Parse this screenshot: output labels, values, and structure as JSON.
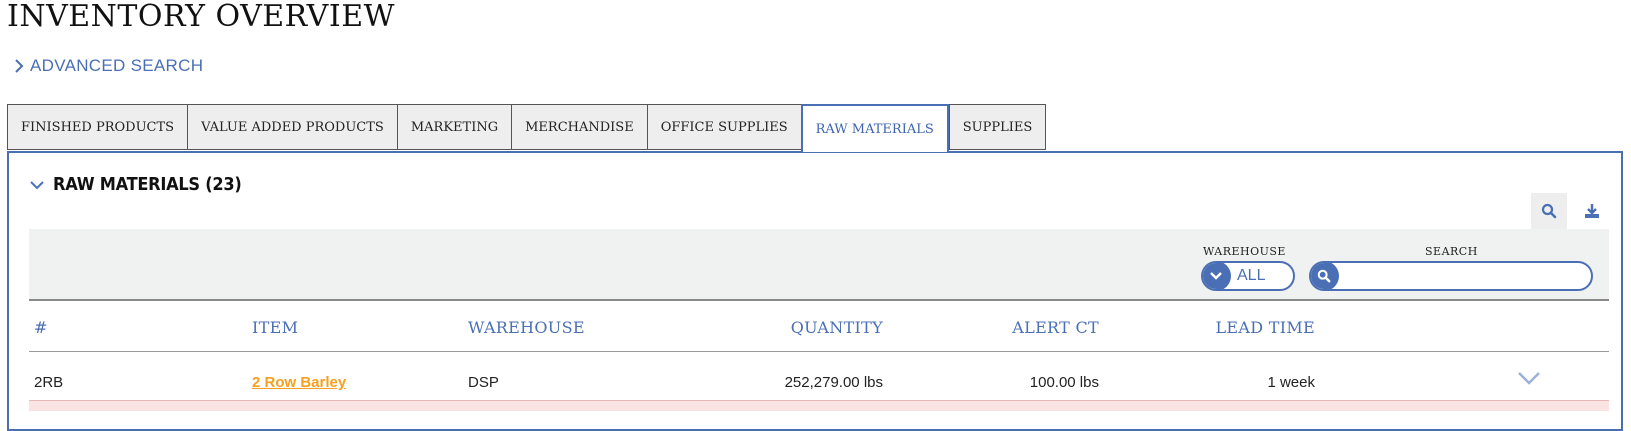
{
  "page": {
    "title": "INVENTORY OVERVIEW"
  },
  "advanced_search": {
    "label": "ADVANCED SEARCH"
  },
  "tabs": [
    {
      "label": "FINISHED PRODUCTS",
      "active": false
    },
    {
      "label": "VALUE ADDED PRODUCTS",
      "active": false
    },
    {
      "label": "MARKETING",
      "active": false
    },
    {
      "label": "MERCHANDISE",
      "active": false
    },
    {
      "label": "OFFICE SUPPLIES",
      "active": false
    },
    {
      "label": "RAW MATERIALS",
      "active": true
    },
    {
      "label": "SUPPLIES",
      "active": false
    }
  ],
  "panel": {
    "title": "RAW MATERIALS (23)",
    "tools": {
      "search_icon": "search-icon",
      "download_icon": "download-icon"
    },
    "filters": {
      "warehouse_label": "WAREHOUSE",
      "warehouse_value": "ALL",
      "search_label": "SEARCH",
      "search_value": ""
    },
    "table": {
      "columns": [
        "#",
        "ITEM",
        "WAREHOUSE",
        "QUANTITY",
        "ALERT CT",
        "LEAD TIME"
      ],
      "rows": [
        {
          "id": "2RB",
          "item": "2 Row Barley",
          "warehouse": "DSP",
          "quantity": "252,279.00 lbs",
          "alert_ct": "100.00 lbs",
          "lead_time": "1 week"
        }
      ]
    }
  },
  "colors": {
    "accent": "#4a6fb5",
    "link": "#f5a020",
    "filter_bg": "#f0f1f1",
    "alert_row": "#fbe3e3"
  }
}
